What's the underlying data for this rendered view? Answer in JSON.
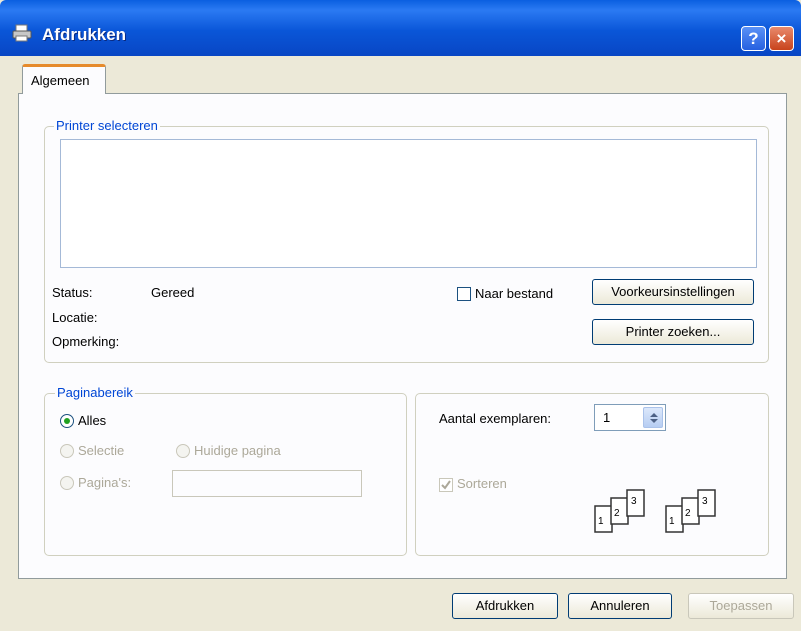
{
  "window": {
    "title": "Afdrukken",
    "help_label": "?",
    "close_label": "×"
  },
  "tab": {
    "label": "Algemeen"
  },
  "printer_group": {
    "title": "Printer selecteren",
    "status_label": "Status:",
    "status_value": "Gereed",
    "location_label": "Locatie:",
    "comment_label": "Opmerking:",
    "print_to_file": {
      "label": "Naar bestand",
      "checked": false
    },
    "preferences_button": "Voorkeursinstellingen",
    "find_printer_button": "Printer zoeken..."
  },
  "range_group": {
    "title": "Paginabereik",
    "all": {
      "label": "Alles",
      "selected": true
    },
    "selection": {
      "label": "Selectie",
      "enabled": false
    },
    "current_page": {
      "label": "Huidige pagina",
      "enabled": false
    },
    "pages": {
      "label": "Pagina's:",
      "enabled": false,
      "value": ""
    }
  },
  "copies_group": {
    "copies_label": "Aantal exemplaren:",
    "copies_value": "1",
    "collate": {
      "label": "Sorteren",
      "checked": true,
      "enabled": false
    },
    "collate_pages": [
      "1",
      "2",
      "3"
    ]
  },
  "footer": {
    "print_button": "Afdrukken",
    "cancel_button": "Annuleren",
    "apply_button": "Toepassen"
  },
  "colors": {
    "title_bar": "#0a56d8",
    "group_title": "#0046d5",
    "panel_bg": "#fcfcfe",
    "dialog_bg": "#ece9d8"
  }
}
